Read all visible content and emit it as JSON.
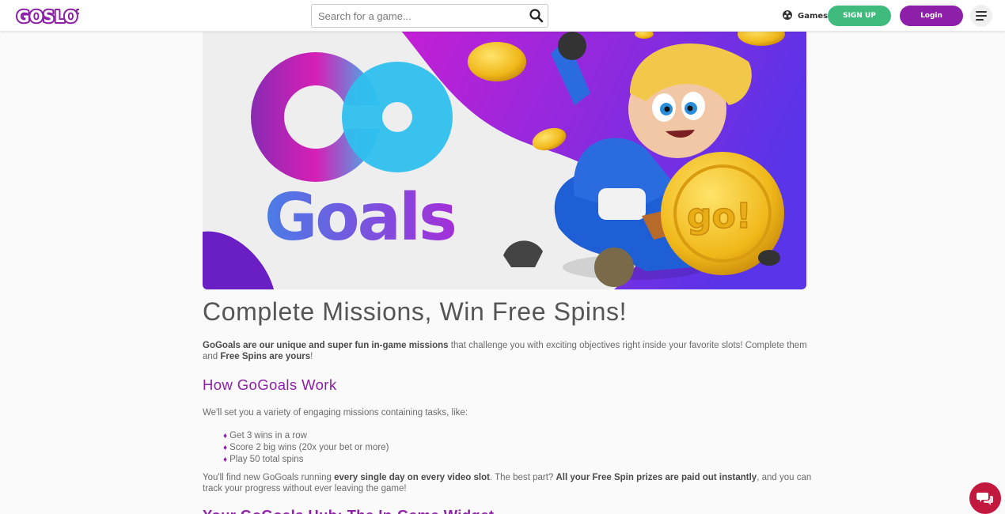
{
  "header": {
    "logo_text": "GOSLOT!",
    "search": {
      "placeholder": "Search for a game..."
    },
    "games_label": "Games",
    "signup_label": "SIGN UP",
    "login_label": "Login"
  },
  "hero": {
    "badge_text": "Go",
    "logo_word": "Goals",
    "coin_text": "go!"
  },
  "content": {
    "title": "Complete Missions, Win Free Spins!",
    "intro": {
      "b1": "GoGoals are our unique and super fun in-game missions",
      "t1": " that challenge you with exciting objectives right inside your favorite slots! Complete them and ",
      "b2": "Free Spins are yours",
      "t2": "!"
    },
    "how_heading": "How GoGoals Work",
    "set_text": "We'll set you a variety of engaging missions containing tasks, like:",
    "tasks": [
      "Get 3 wins in a row",
      "Score 2 big wins (20x your bet or more)",
      "Play 50 total spins"
    ],
    "bullet": "♦",
    "find": {
      "t1": "You'll find new GoGoals running ",
      "b1": "every single day on every video slot",
      "t2": ". The best part? ",
      "b2": "All your Free Spin prizes are paid out instantly",
      "t3": ", and you can track your progress without ever leaving the game!"
    },
    "next_heading": "Your GoGoals Hub: The In-Game Widget"
  },
  "colors": {
    "brand_purple": "#8e1fa8",
    "signup_green": "#3fbb7d",
    "chat_red": "#c2183e",
    "coin_gold": "#f2c21e"
  },
  "icons": {
    "search": "search-icon",
    "games": "games-icon",
    "menu": "hamburger-menu-icon",
    "chat": "chat-icon"
  }
}
